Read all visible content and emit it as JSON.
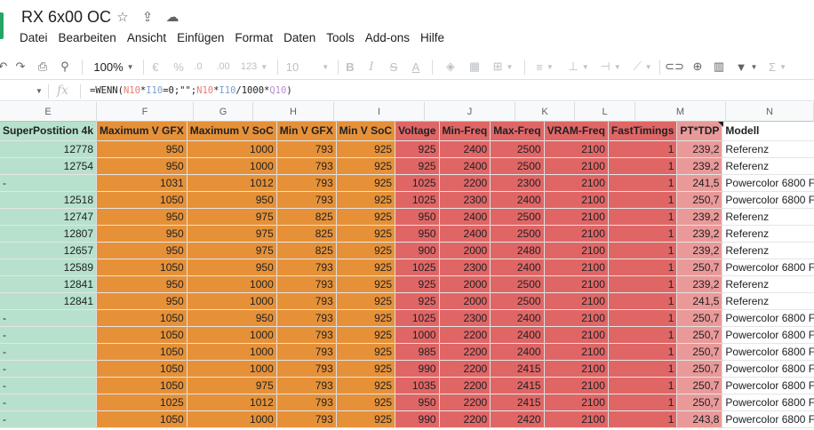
{
  "app": {
    "doc_title": "RX 6x00 OC",
    "menu": [
      "Datei",
      "Bearbeiten",
      "Ansicht",
      "Einfügen",
      "Format",
      "Daten",
      "Tools",
      "Add-ons",
      "Hilfe"
    ]
  },
  "toolbar": {
    "zoom": "100%",
    "currency": "€",
    "percent": "%",
    "dec_decrease": ".0",
    "dec_increase": ".00",
    "more_formats": "123",
    "font_size": "10",
    "bold": "B",
    "italic": "I",
    "strike": "S",
    "text_color": "A"
  },
  "formula_bar": {
    "fx": "fx",
    "parts": [
      "=WENN(",
      "N10",
      "*",
      "I10",
      "=0;\"\";",
      "N10",
      "*",
      "I10",
      "/1000*",
      "Q10",
      ")"
    ]
  },
  "columns": [
    "E",
    "F",
    "G",
    "H",
    "I",
    "J",
    "K",
    "L",
    "M",
    "N"
  ],
  "header_row": [
    "SuperPostition 4k",
    "Maximum V GFX",
    "Maximum V SoC",
    "Min V GFX",
    "Min V SoC",
    "Voltage",
    "Min-Freq",
    "Max-Freq",
    "VRAM-Freq",
    "FastTimings",
    "PT*TDP",
    "Modell"
  ],
  "rows": [
    [
      "12778",
      "950",
      "1000",
      "793",
      "925",
      "925",
      "2400",
      "2500",
      "2100",
      "1",
      "239,2",
      "Referenz"
    ],
    [
      "12754",
      "950",
      "1000",
      "793",
      "925",
      "925",
      "2400",
      "2500",
      "2100",
      "1",
      "239,2",
      "Referenz"
    ],
    [
      "-",
      "1031",
      "1012",
      "793",
      "925",
      "1025",
      "2200",
      "2300",
      "2100",
      "1",
      "241,5",
      "Powercolor 6800 F"
    ],
    [
      "12518",
      "1050",
      "950",
      "793",
      "925",
      "1025",
      "2300",
      "2400",
      "2100",
      "1",
      "250,7",
      "Powercolor 6800 F"
    ],
    [
      "12747",
      "950",
      "975",
      "825",
      "925",
      "950",
      "2400",
      "2500",
      "2100",
      "1",
      "239,2",
      "Referenz"
    ],
    [
      "12807",
      "950",
      "975",
      "825",
      "925",
      "950",
      "2400",
      "2500",
      "2100",
      "1",
      "239,2",
      "Referenz"
    ],
    [
      "12657",
      "950",
      "975",
      "825",
      "925",
      "900",
      "2000",
      "2480",
      "2100",
      "1",
      "239,2",
      "Referenz"
    ],
    [
      "12589",
      "1050",
      "950",
      "793",
      "925",
      "1025",
      "2300",
      "2400",
      "2100",
      "1",
      "250,7",
      "Powercolor 6800 F"
    ],
    [
      "12841",
      "950",
      "1000",
      "793",
      "925",
      "925",
      "2000",
      "2500",
      "2100",
      "1",
      "239,2",
      "Referenz"
    ],
    [
      "12841",
      "950",
      "1000",
      "793",
      "925",
      "925",
      "2000",
      "2500",
      "2100",
      "1",
      "241,5",
      "Referenz"
    ],
    [
      "-",
      "1050",
      "950",
      "793",
      "925",
      "1025",
      "2300",
      "2400",
      "2100",
      "1",
      "250,7",
      "Powercolor 6800 F"
    ],
    [
      "-",
      "1050",
      "1000",
      "793",
      "925",
      "1000",
      "2200",
      "2400",
      "2100",
      "1",
      "250,7",
      "Powercolor 6800 F"
    ],
    [
      "-",
      "1050",
      "1000",
      "793",
      "925",
      "985",
      "2200",
      "2400",
      "2100",
      "1",
      "250,7",
      "Powercolor 6800 F"
    ],
    [
      "-",
      "1050",
      "1000",
      "793",
      "925",
      "990",
      "2200",
      "2415",
      "2100",
      "1",
      "250,7",
      "Powercolor 6800 F"
    ],
    [
      "-",
      "1050",
      "975",
      "793",
      "925",
      "1035",
      "2200",
      "2415",
      "2100",
      "1",
      "250,7",
      "Powercolor 6800 F"
    ],
    [
      "-",
      "1025",
      "1012",
      "793",
      "925",
      "950",
      "2200",
      "2415",
      "2100",
      "1",
      "250,7",
      "Powercolor 6800 F"
    ],
    [
      "-",
      "1050",
      "1000",
      "793",
      "925",
      "990",
      "2200",
      "2420",
      "2100",
      "1",
      "243,8",
      "Powercolor 6800 F"
    ]
  ],
  "colors": {
    "col_E": "#b7e1cd",
    "col_F_I": "#e69138",
    "col_J_L": "#e06666",
    "col_M": "#ea9999",
    "sheets_green": "#23a566"
  }
}
